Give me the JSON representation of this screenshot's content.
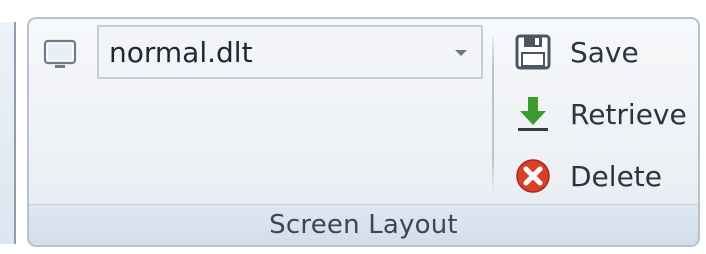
{
  "combo": {
    "value": "normal.dlt"
  },
  "actions": {
    "save_label": "Save",
    "retrieve_label": "Retrieve",
    "delete_label": "Delete"
  },
  "group": {
    "label": "Screen Layout"
  },
  "icons": {
    "layout": "monitor-icon",
    "save": "floppy-disk-icon",
    "retrieve": "download-arrow-icon",
    "delete": "delete-x-circle-icon",
    "dropdown": "chevron-down-icon"
  },
  "colors": {
    "retrieve_arrow": "#3d9a2e",
    "delete_circle": "#d9402a"
  }
}
